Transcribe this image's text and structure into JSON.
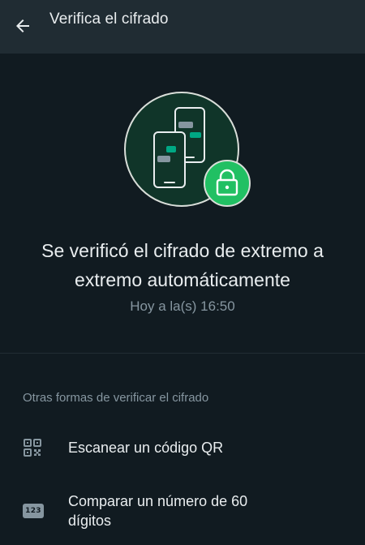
{
  "header": {
    "back_icon": "arrow-left-icon",
    "title": "Verifica el cifrado"
  },
  "illustration": {
    "icons": [
      "phone-icon",
      "phone-icon",
      "lock-icon"
    ],
    "colors": {
      "circle_fill": "#103529",
      "accent": "#00a884",
      "lock_badge": "#21c063"
    }
  },
  "status": {
    "headline": "Se verificó el cifrado de extremo a extremo automáticamente",
    "timestamp": "Hoy a la(s) 16:50"
  },
  "other_methods": {
    "section_label": "Otras formas de verificar el cifrado",
    "options": [
      {
        "icon": "qr-code-icon",
        "label": "Escanear un código QR"
      },
      {
        "icon": "number-123-icon",
        "icon_text": "123",
        "label": "Comparar un número de 60 dígitos"
      }
    ]
  }
}
